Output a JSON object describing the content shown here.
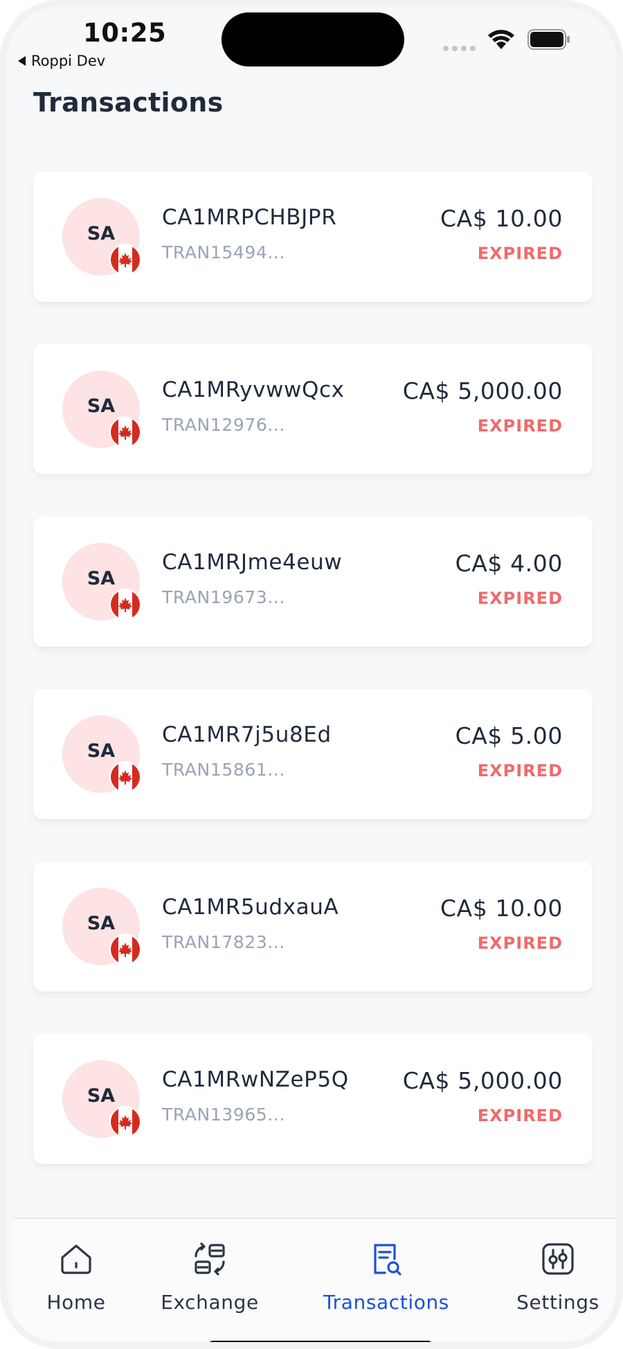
{
  "status_bar": {
    "time": "10:25",
    "back_app": "Roppi Dev"
  },
  "page": {
    "title": "Transactions"
  },
  "transactions": [
    {
      "initials": "SA",
      "reference": "CA1MRPCHBJPR",
      "transaction_id": "TRAN15494...",
      "amount": "CA$ 10.00",
      "status": "EXPIRED"
    },
    {
      "initials": "SA",
      "reference": "CA1MRyvwwQcx",
      "transaction_id": "TRAN12976...",
      "amount": "CA$ 5,000.00",
      "status": "EXPIRED"
    },
    {
      "initials": "SA",
      "reference": "CA1MRJme4euw",
      "transaction_id": "TRAN19673...",
      "amount": "CA$ 4.00",
      "status": "EXPIRED"
    },
    {
      "initials": "SA",
      "reference": "CA1MR7j5u8Ed",
      "transaction_id": "TRAN15861...",
      "amount": "CA$ 5.00",
      "status": "EXPIRED"
    },
    {
      "initials": "SA",
      "reference": "CA1MR5udxauA",
      "transaction_id": "TRAN17823...",
      "amount": "CA$ 10.00",
      "status": "EXPIRED"
    },
    {
      "initials": "SA",
      "reference": "CA1MRwNZeP5Q",
      "transaction_id": "TRAN13965...",
      "amount": "CA$ 5,000.00",
      "status": "EXPIRED"
    }
  ],
  "tab_bar": {
    "home": "Home",
    "exchange": "Exchange",
    "transactions": "Transactions",
    "settings": "Settings",
    "active": "transactions"
  },
  "colors": {
    "accent": "#1e4fd8",
    "expired": "#f06a6a",
    "avatar_bg": "#fde3e3",
    "flag_red": "#d52b1e"
  },
  "icons": {
    "flag": "canada-flag-icon",
    "home": "home-icon",
    "exchange": "exchange-icon",
    "transactions": "receipt-search-icon",
    "settings": "sliders-icon"
  }
}
